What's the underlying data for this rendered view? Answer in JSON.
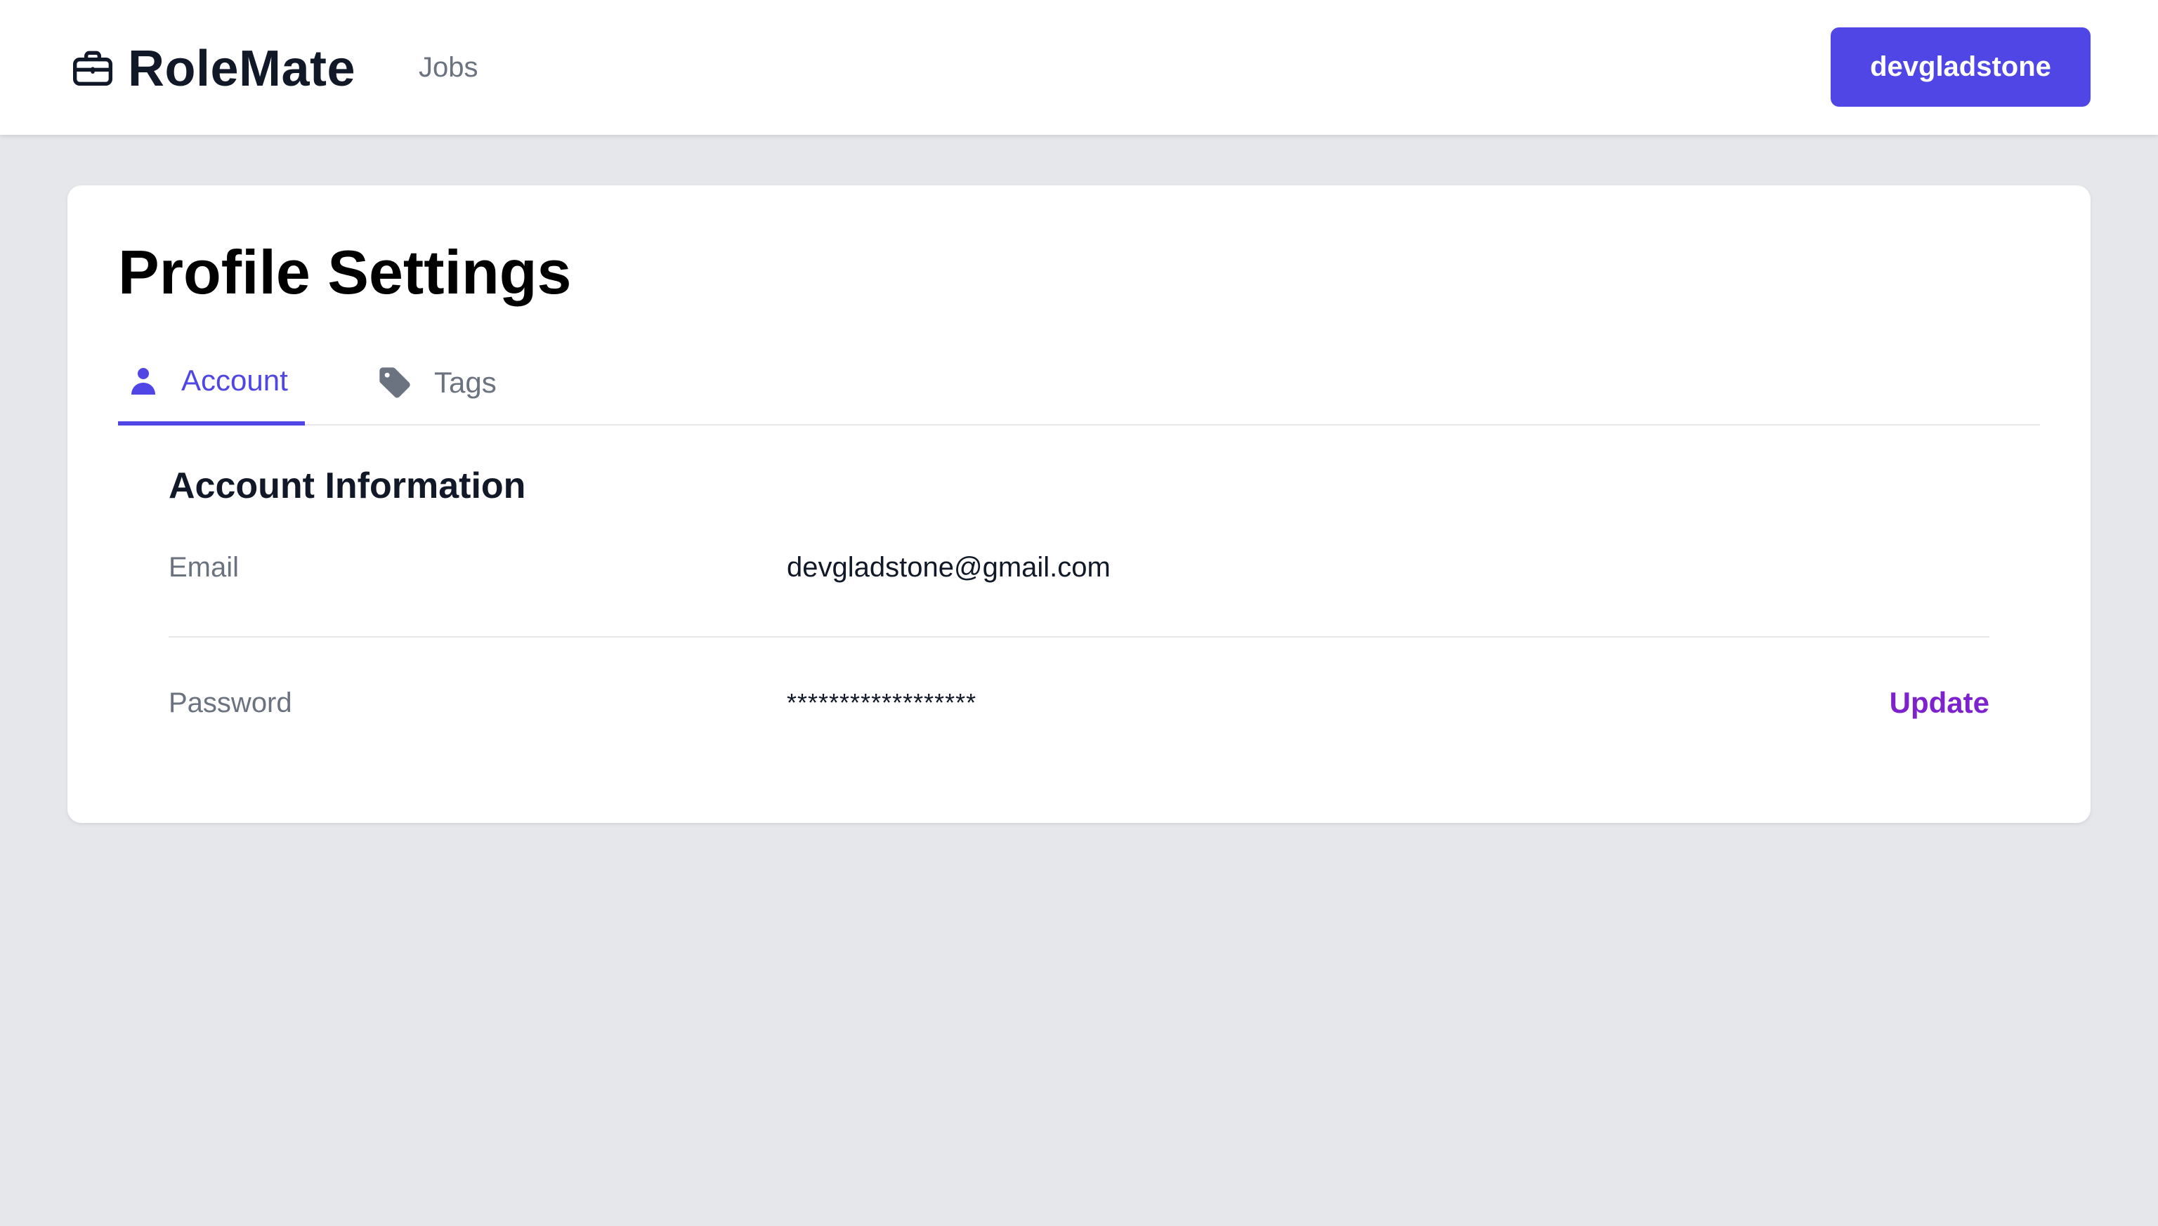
{
  "navbar": {
    "brand_name": "RoleMate",
    "brand_icon": "briefcase-icon",
    "links": [
      {
        "label": "Jobs"
      }
    ],
    "user_button_label": "devgladstone"
  },
  "page": {
    "title": "Profile Settings",
    "tabs": [
      {
        "label": "Account",
        "icon": "user-icon",
        "active": true
      },
      {
        "label": "Tags",
        "icon": "tag-icon",
        "active": false
      }
    ],
    "section_title": "Account Information",
    "fields": [
      {
        "label": "Email",
        "value": "devgladstone@gmail.com",
        "action": ""
      },
      {
        "label": "Password",
        "value": "******************",
        "action": "Update"
      }
    ]
  },
  "colors": {
    "accent": "#4f46e5",
    "action_link": "#7e22ce",
    "muted_text": "#6b7280",
    "page_background": "#e5e7eb"
  }
}
